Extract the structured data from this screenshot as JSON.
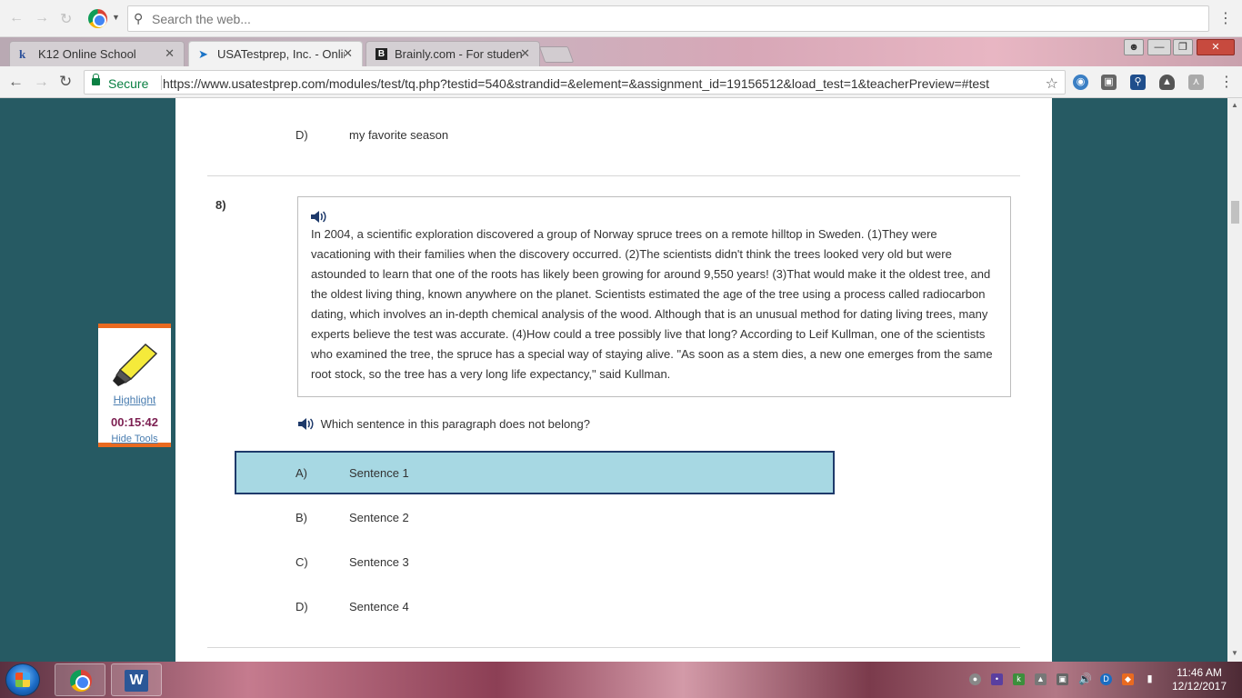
{
  "search_bar": {
    "placeholder": "Search the web..."
  },
  "tabs": [
    {
      "favicon": "k12",
      "title": "K12 Online School"
    },
    {
      "favicon": "cursor-arrow-icon",
      "title": "USATestprep, Inc. - Onlin"
    },
    {
      "favicon": "B",
      "title": "Brainly.com - For student"
    }
  ],
  "address": {
    "secure_label": "Secure",
    "url": "https://www.usatestprep.com/modules/test/tq.php?testid=540&strandid=&element=&assignment_id=19156512&load_test=1&teacherPreview=#test"
  },
  "prev_question": {
    "letter": "D)",
    "text": "my favorite season"
  },
  "question": {
    "number": "8)",
    "passage": "In 2004, a scientific exploration discovered a group of Norway spruce trees on a remote hilltop in Sweden. (1)They were vacationing with their families when the discovery occurred. (2)The scientists didn't think the trees looked very old but were astounded to learn that one of the roots has likely been growing for around 9,550 years! (3)That would make it the oldest tree, and the oldest living thing, known anywhere on the planet. Scientists estimated the age of the tree using a process called radiocarbon dating, which involves an in-depth chemical analysis of the wood. Although that is an unusual method for dating living trees, many experts believe the test was accurate. (4)How could a tree possibly live that long? According to Leif Kullman, one of the scientists who examined the tree, the spruce has a special way of staying alive. \"As soon as a stem dies, a new one emerges from the same root stock, so the tree has a very long life expectancy,\" said Kullman.",
    "prompt": "Which sentence in this paragraph does not belong?",
    "choices": [
      {
        "letter": "A)",
        "text": "Sentence 1",
        "selected": true
      },
      {
        "letter": "B)",
        "text": "Sentence 2",
        "selected": false
      },
      {
        "letter": "C)",
        "text": "Sentence 3",
        "selected": false
      },
      {
        "letter": "D)",
        "text": "Sentence 4",
        "selected": false
      }
    ]
  },
  "tools": {
    "highlight_label": "Highlight",
    "timer": "00:15:42",
    "hide_label": "Hide Tools"
  },
  "taskbar": {
    "time": "11:46 AM",
    "date": "12/12/2017",
    "word_label": "W"
  },
  "colors": {
    "selected_bg": "#a7d8e3",
    "selected_border": "#1e3a6b",
    "page_bg": "#265a63",
    "tool_accent": "#e96a20",
    "timer": "#7c1f51"
  }
}
